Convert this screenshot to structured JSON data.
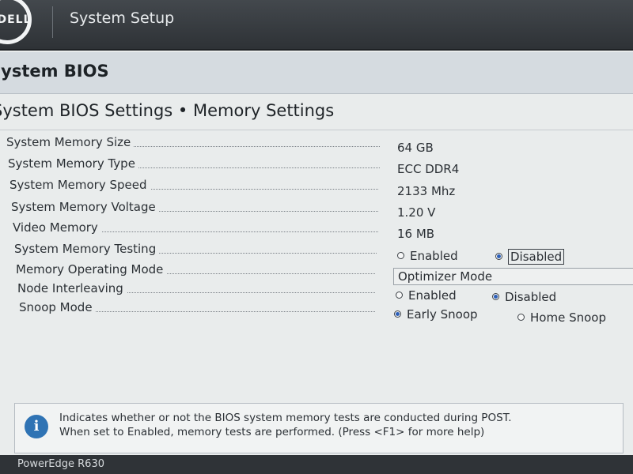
{
  "header": {
    "logo_text": "DELL",
    "title": "System Setup"
  },
  "section": {
    "title": "System BIOS"
  },
  "page": {
    "title": "System BIOS Settings • Memory Settings"
  },
  "settings": [
    {
      "label": "System Memory Size",
      "value": "64 GB"
    },
    {
      "label": "System Memory Type",
      "value": "ECC DDR4"
    },
    {
      "label": "System Memory Speed",
      "value": "2133 Mhz"
    },
    {
      "label": "System Memory Voltage",
      "value": "1.20 V"
    },
    {
      "label": "Video Memory",
      "value": "16 MB"
    },
    {
      "label": "System Memory Testing",
      "options": [
        "Enabled",
        "Disabled"
      ],
      "selected": "Disabled"
    },
    {
      "label": "Memory Operating Mode",
      "value": "Optimizer Mode"
    },
    {
      "label": "Node Interleaving",
      "options": [
        "Enabled",
        "Disabled"
      ],
      "selected": "Disabled"
    },
    {
      "label": "Snoop Mode",
      "options": [
        "Early Snoop",
        "Home Snoop"
      ],
      "selected": "Early Snoop"
    }
  ],
  "help": {
    "icon": "info-icon",
    "line1": "Indicates whether or not the BIOS system memory tests are conducted during POST.",
    "line2": "When set to Enabled, memory tests are performed. (Press <F1> for more help)"
  },
  "footer": {
    "model": "PowerEdge R630"
  },
  "colors": {
    "accent": "#2f73b4",
    "radio_selected": "#2c5fb8",
    "topbar": "#3a3f44"
  }
}
